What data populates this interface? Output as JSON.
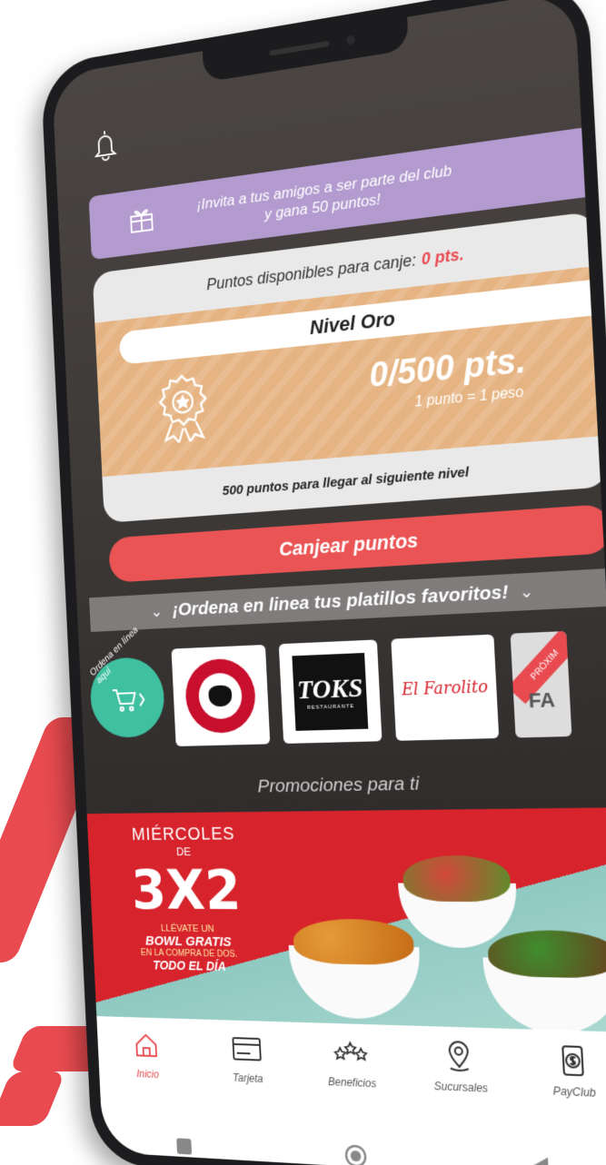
{
  "invite": {
    "text": "¡Invita a tus amigos a ser parte del club y gana 50 puntos!"
  },
  "points_card": {
    "available_label": "Puntos disponibles para canje:",
    "available_value": "0 pts.",
    "level": "Nivel Oro",
    "progress": "0/500 pts.",
    "rate": "1 punto = 1 peso",
    "next_level": "500 puntos para llegar al siguiente nivel"
  },
  "redeem_button": "Canjear puntos",
  "order_bar": {
    "text": "¡Ordena en linea tus platillos favoritos!"
  },
  "order_online": {
    "label": "Ordena en línea aquí"
  },
  "brands": {
    "toks": {
      "name": "TOKS",
      "sub": "RESTAURANTE"
    },
    "farolito": {
      "name": "El Farolito"
    },
    "coming_soon": {
      "ribbon": "PRÓXIM",
      "partial": "FA"
    }
  },
  "promotions": {
    "title": "Promociones para ti",
    "banner": {
      "day": "MIÉRCOLES",
      "de": "DE",
      "promo": "3X2",
      "line1": "LLÉVATE UN",
      "line2": "BOWL GRATIS",
      "line3": "EN LA COMPRA DE DOS.",
      "line4": "TODO EL DÍA"
    }
  },
  "tabbar": {
    "items": [
      {
        "label": "Inicio",
        "icon": "home-icon",
        "active": true
      },
      {
        "label": "Tarjeta",
        "icon": "card-icon",
        "active": false
      },
      {
        "label": "Beneficios",
        "icon": "stars-icon",
        "active": false
      },
      {
        "label": "Sucursales",
        "icon": "location-icon",
        "active": false
      },
      {
        "label": "PayClub",
        "icon": "payclub-icon",
        "active": false
      }
    ]
  },
  "colors": {
    "accent": "#e84a4f",
    "purple": "#b39bcf",
    "gold": "#e6b482",
    "teal": "#3fc0a0"
  }
}
